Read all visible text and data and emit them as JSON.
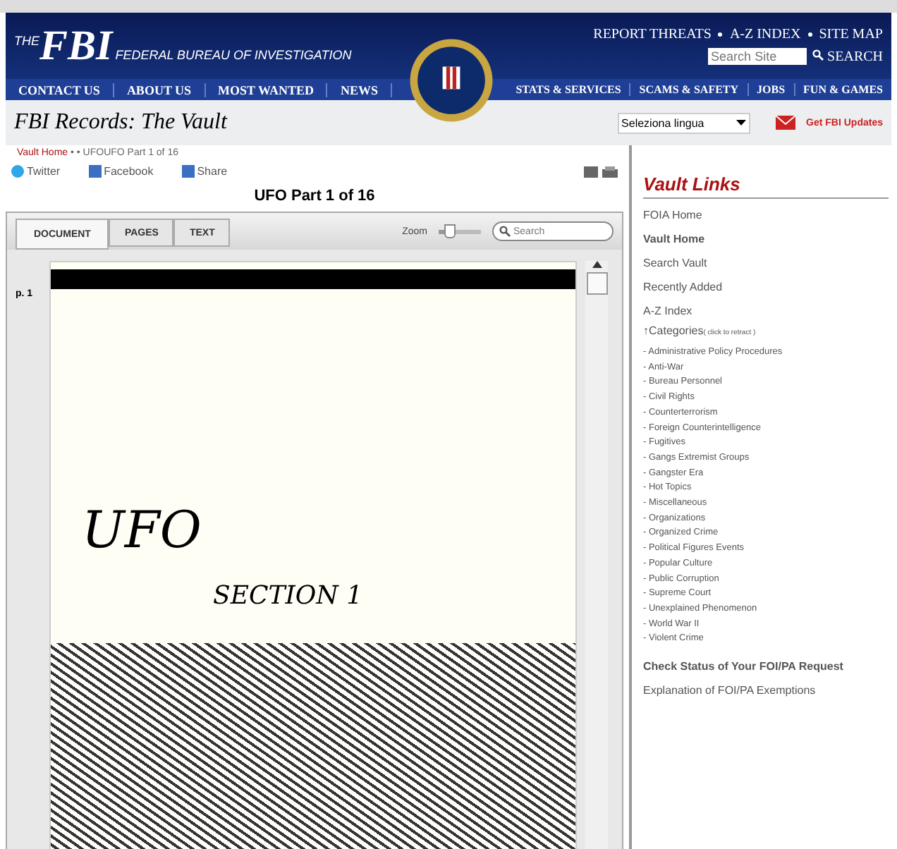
{
  "header": {
    "logo_small": "THE",
    "logo": "FBI",
    "agency": "FEDERAL BUREAU OF INVESTIGATION",
    "top_links": [
      "REPORT THREATS",
      "A-Z INDEX",
      "SITE MAP"
    ],
    "search": {
      "placeholder": "Search Site",
      "button": "SEARCH"
    }
  },
  "nav_left": [
    "CONTACT US",
    "ABOUT US",
    "MOST WANTED",
    "NEWS"
  ],
  "nav_right": [
    "STATS & SERVICES",
    "SCAMS & SAFETY",
    "JOBS",
    "FUN & GAMES"
  ],
  "banner": {
    "title": "FBI Records: The Vault",
    "language_select": "Seleziona lingua",
    "updates": "Get FBI Updates"
  },
  "breadcrumb": {
    "link": "Vault Home",
    "rest": " •  • UFOUFO Part 1 of 16"
  },
  "share": [
    "Twitter",
    "Facebook",
    "Share"
  ],
  "document": {
    "title": "UFO Part 1 of 16",
    "tabs": [
      {
        "label": "DOCUMENT",
        "selected": true
      },
      {
        "label": "PAGES",
        "selected": false
      },
      {
        "label": "TEXT",
        "selected": false
      }
    ],
    "zoom_label": "Zoom",
    "zoom": {
      "level": 0.25
    },
    "search_placeholder": "Search",
    "page_label": "p. 1",
    "page_text": [
      "UFO",
      "SECTION 1"
    ]
  },
  "sidebar": {
    "title": "Vault Links",
    "links": [
      {
        "label": "FOIA Home",
        "bold": false
      },
      {
        "label": "Vault Home",
        "bold": true
      },
      {
        "label": "Search Vault",
        "bold": false
      },
      {
        "label": "Recently Added",
        "bold": false
      },
      {
        "label": "A-Z Index",
        "bold": false
      }
    ],
    "categories": {
      "label": "↑Categories",
      "hint": "( click to retract )",
      "expanded": true,
      "items": [
        "- Administrative Policy Procedures",
        "- Anti-War",
        "- Bureau Personnel",
        "- Civil Rights",
        "- Counterterrorism",
        "- Foreign Counterintelligence",
        "- Fugitives",
        "- Gangs Extremist Groups",
        "- Gangster Era",
        "- Hot Topics",
        "- Miscellaneous",
        "- Organizations",
        "- Organized Crime",
        "- Political Figures Events",
        "- Popular Culture",
        "- Public Corruption",
        "- Supreme Court",
        "- Unexplained Phenomenon",
        "- World War II",
        "- Violent Crime"
      ]
    },
    "footer_links": [
      {
        "label": "Check Status of Your FOI/PA Request",
        "bold": true
      },
      {
        "label": "Explanation of FOI/PA Exemptions",
        "bold": false
      }
    ]
  }
}
